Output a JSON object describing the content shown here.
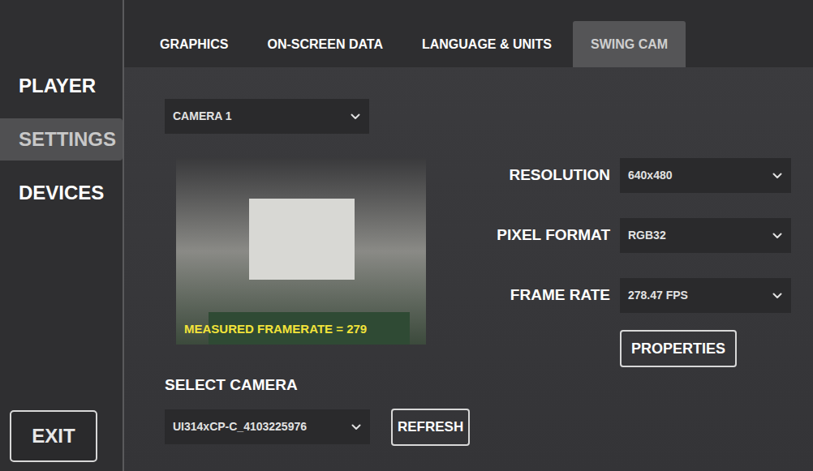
{
  "sidebar": {
    "items": [
      {
        "label": "PLAYER",
        "selected": false
      },
      {
        "label": "SETTINGS",
        "selected": true
      },
      {
        "label": "DEVICES",
        "selected": false
      }
    ],
    "exit_button": "EXIT"
  },
  "tabs": [
    {
      "label": "GRAPHICS",
      "selected": false
    },
    {
      "label": "ON-SCREEN DATA",
      "selected": false
    },
    {
      "label": "LANGUAGE & UNITS",
      "selected": false
    },
    {
      "label": "SWING CAM",
      "selected": true
    }
  ],
  "camera_dropdown": {
    "value": "CAMERA 1"
  },
  "preview": {
    "overlay": "MEASURED FRAMERATE = 279"
  },
  "settings": [
    {
      "label": "RESOLUTION",
      "value": "640x480"
    },
    {
      "label": "PIXEL FORMAT",
      "value": "RGB32"
    },
    {
      "label": "FRAME RATE",
      "value": "278.47 FPS"
    }
  ],
  "properties_button": "PROPERTIES",
  "select_camera": {
    "label": "SELECT CAMERA",
    "value": "UI314xCP-C_4103225976",
    "refresh_button": "REFRESH"
  }
}
